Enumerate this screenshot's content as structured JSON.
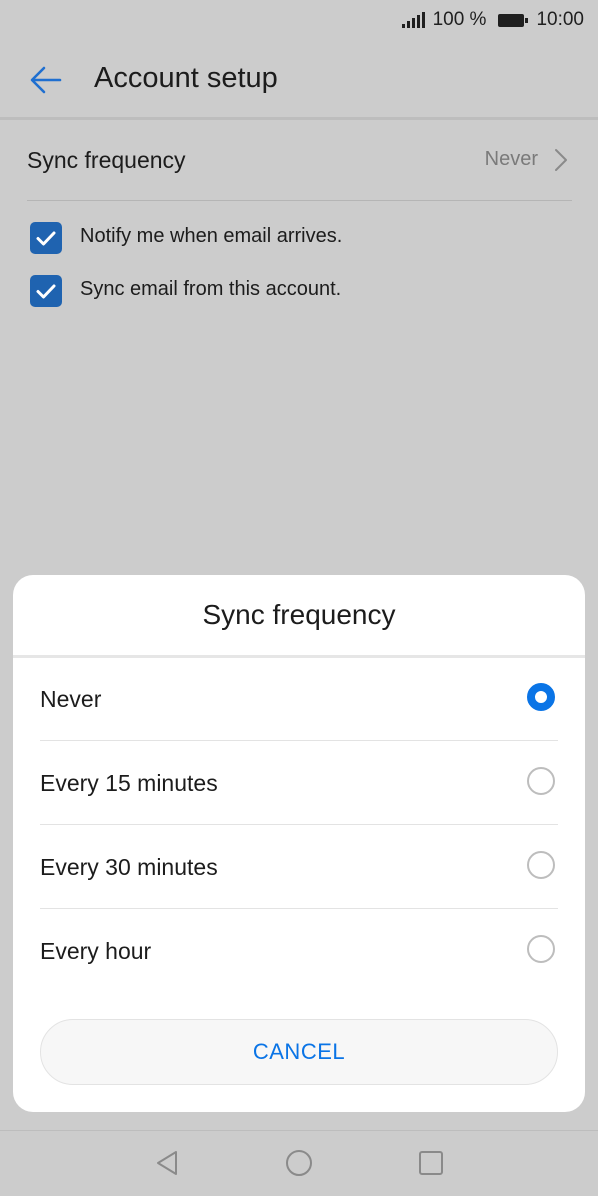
{
  "status_bar": {
    "battery_percent": "100 %",
    "time": "10:00"
  },
  "header": {
    "title": "Account setup"
  },
  "settings": {
    "sync_frequency_label": "Sync frequency",
    "sync_frequency_value": "Never",
    "checkboxes": [
      {
        "label": "Notify me when email arrives.",
        "checked": true
      },
      {
        "label": "Sync email from this account.",
        "checked": true
      }
    ]
  },
  "dialog": {
    "title": "Sync frequency",
    "options": [
      {
        "label": "Never",
        "selected": true
      },
      {
        "label": "Every 15 minutes",
        "selected": false
      },
      {
        "label": "Every 30 minutes",
        "selected": false
      },
      {
        "label": "Every hour",
        "selected": false
      }
    ],
    "cancel_label": "CANCEL"
  },
  "colors": {
    "accent": "#0a74e6",
    "checkbox": "#1f63b0",
    "scrim_background": "#cccccc"
  }
}
